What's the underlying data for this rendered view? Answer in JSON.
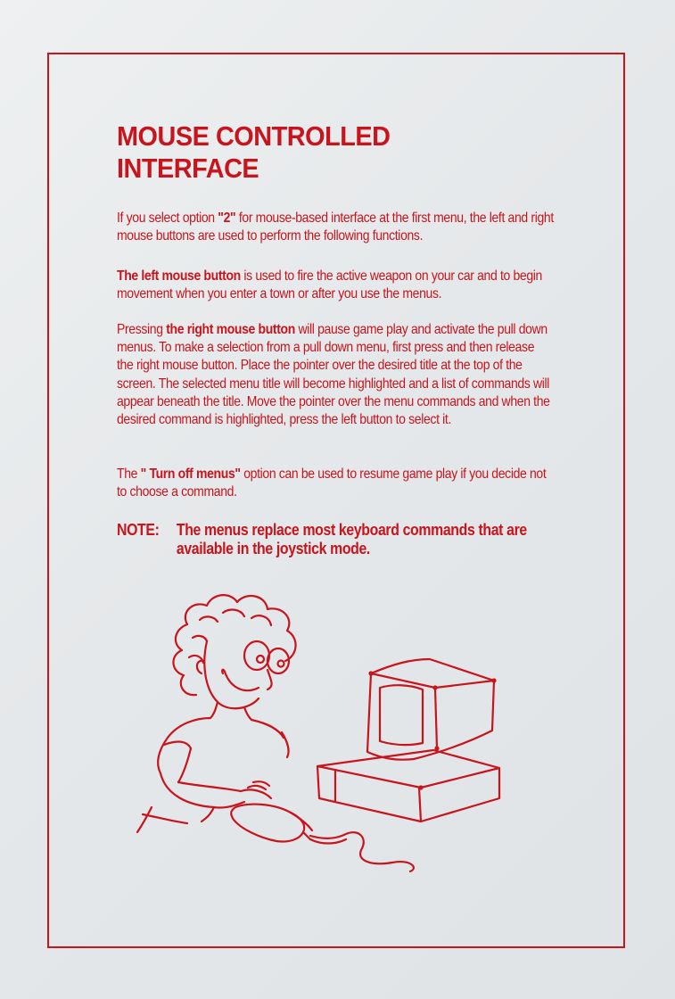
{
  "page": {
    "accent_color": "#c8141c",
    "background_color": "#e6e9ea"
  },
  "heading": {
    "line1": "MOUSE CONTROLLED",
    "line2": "INTERFACE"
  },
  "paragraphs": {
    "p1": {
      "pre": "If you select option ",
      "bold": "\"2\"",
      "post": " for mouse-based interface at the first menu, the left and right mouse buttons are used to perform the following functions."
    },
    "p2": {
      "bold": "The left mouse button",
      "post": " is used to fire the active weapon on your car and to begin movement when you enter a town or after you use the menus."
    },
    "p3": {
      "pre": "Pressing ",
      "bold": "the right mouse button",
      "post": " will pause game play and activate the pull down menus. To make a selection from a pull down menu, first press and then release the right mouse button. Place the pointer over the desired title at the top of the screen. The selected menu title will become highlighted and a list of commands will appear beneath the title. Move the pointer over the menu commands and when the desired command is highlighted, press the left button to select it."
    },
    "p4": {
      "pre": "The ",
      "bold": "\" Turn off menus\"",
      "post": " option can be used to resume game play if you decide not to choose a command."
    }
  },
  "note": {
    "label": "NOTE:",
    "text": "The menus replace most keyboard commands that are available in the joystick mode."
  },
  "illustration": {
    "icon": "cartoon-person-using-computer-mouse"
  }
}
